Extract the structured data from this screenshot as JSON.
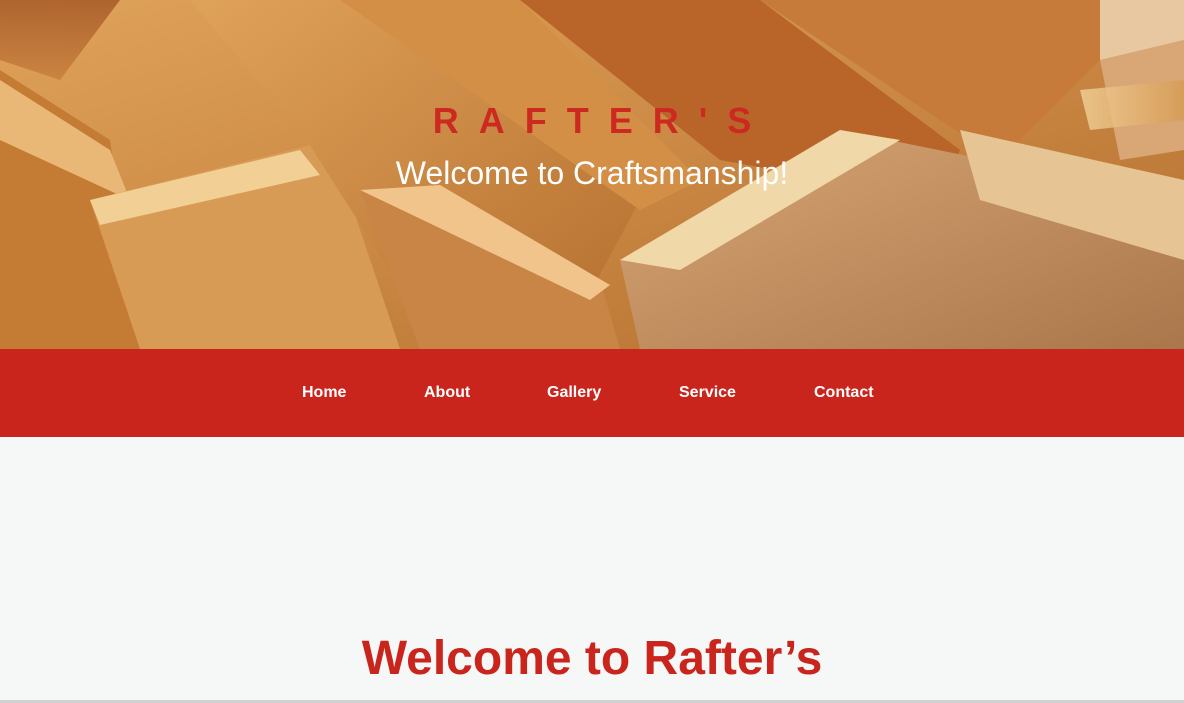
{
  "hero": {
    "brand": "RAFTER'S",
    "tagline": "Welcome to Craftsmanship!"
  },
  "nav": {
    "items": [
      {
        "label": "Home"
      },
      {
        "label": "About"
      },
      {
        "label": "Gallery"
      },
      {
        "label": "Service"
      },
      {
        "label": "Contact"
      }
    ]
  },
  "main": {
    "heading": "Welcome to Rafter’s"
  },
  "colors": {
    "accent_red": "#c9251d",
    "background": "#f6f7f7",
    "text_light": "#ffffff"
  }
}
